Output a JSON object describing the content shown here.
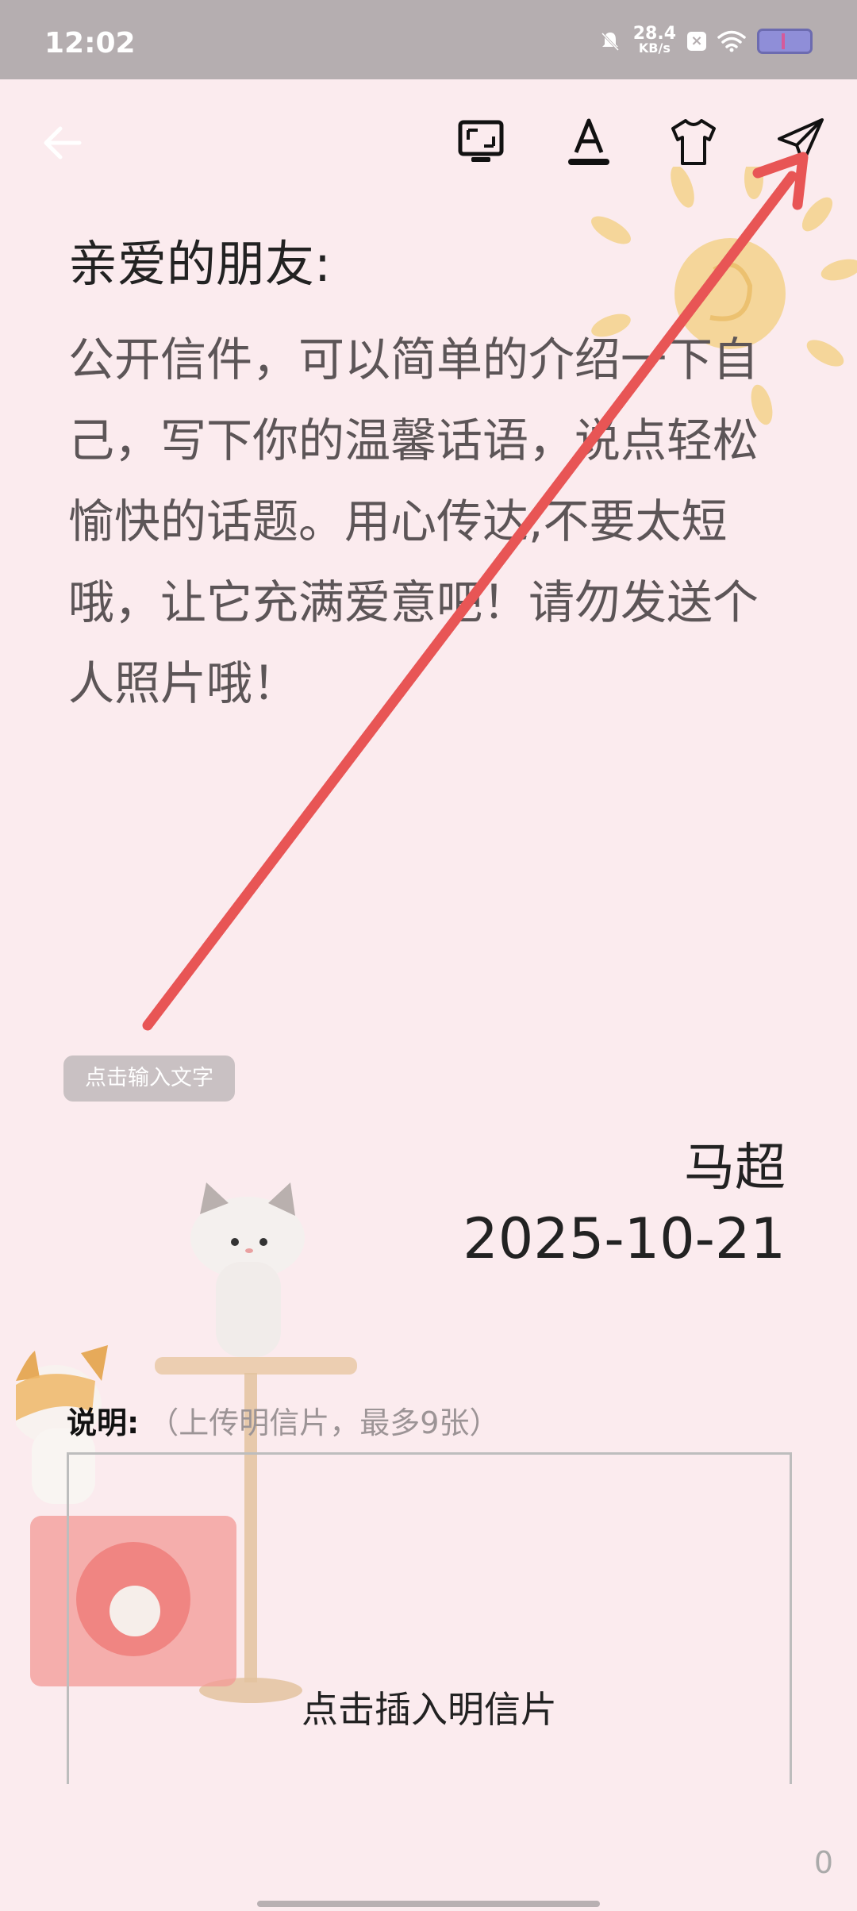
{
  "status_bar": {
    "time": "12:02",
    "net_speed_value": "28.4",
    "net_speed_unit": "KB/s"
  },
  "toolbar": {
    "icons": [
      "back-arrow-icon",
      "frame-icon",
      "text-style-icon",
      "shirt-icon",
      "send-icon"
    ]
  },
  "letter": {
    "greeting": "亲爱的朋友:",
    "body": "公开信件，可以简单的介绍一下自己，写下你的温馨话语，说点轻松愉快的话题。用心传达,不要太短哦，让它充满爱意吧！请勿发送个人照片哦！",
    "input_hint": "点击输入文字",
    "signature": "马超",
    "date": "2025-10-21"
  },
  "attachment": {
    "label": "说明:",
    "hint": "（上传明信片，最多9张）",
    "upload_text": "点击插入明信片"
  },
  "char_count": "0",
  "colors": {
    "background": "#fbebee",
    "status_bar": "#b5aeb0",
    "annotation_arrow": "#e85555"
  }
}
